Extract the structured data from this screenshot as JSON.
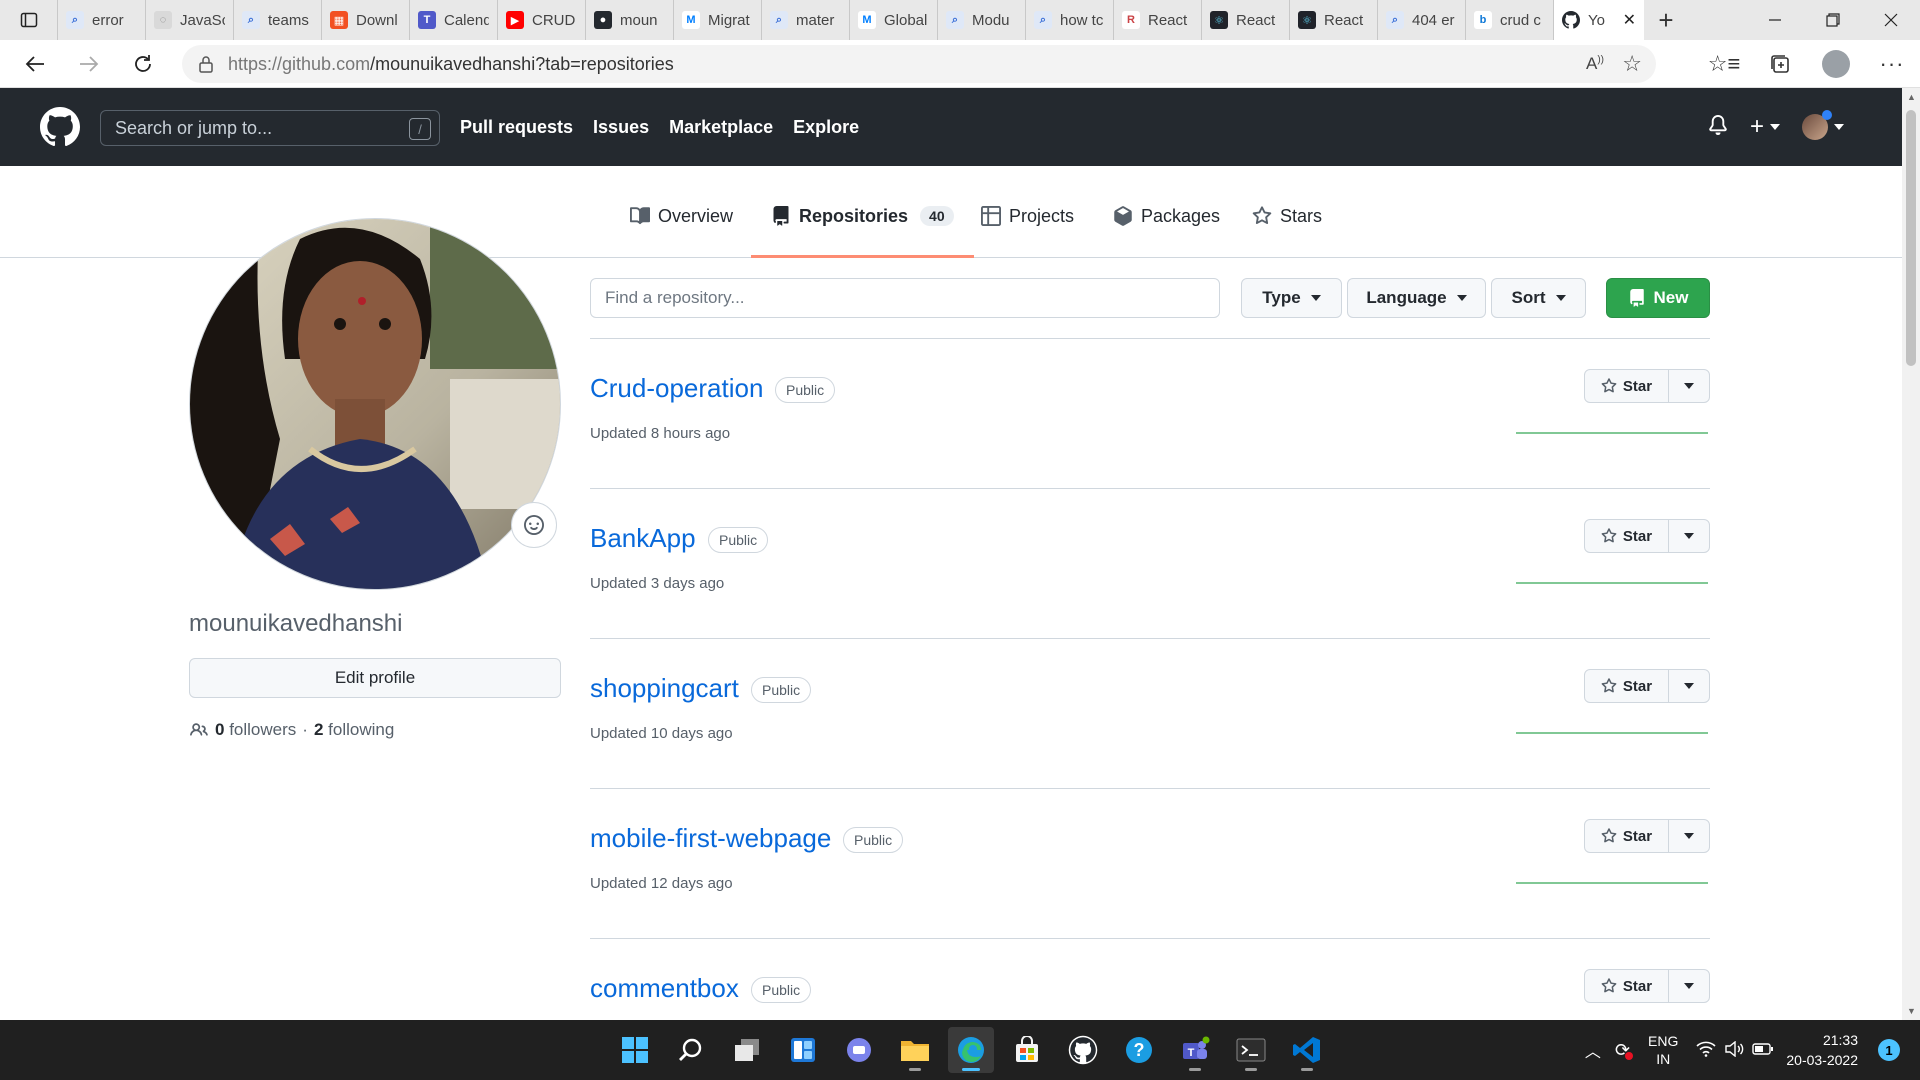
{
  "browser": {
    "tabs": [
      {
        "title": "error",
        "icon": "search-icon"
      },
      {
        "title": "JavaSc",
        "icon": "globe-icon"
      },
      {
        "title": "teams",
        "icon": "search-icon"
      },
      {
        "title": "Downl",
        "icon": "microsoft-icon"
      },
      {
        "title": "Calend",
        "icon": "teams-icon"
      },
      {
        "title": "CRUD",
        "icon": "youtube-icon"
      },
      {
        "title": "moun",
        "icon": "github-icon"
      },
      {
        "title": "Migrat",
        "icon": "mui-icon"
      },
      {
        "title": "mater",
        "icon": "search-icon"
      },
      {
        "title": "Global",
        "icon": "mui-icon"
      },
      {
        "title": "Modu",
        "icon": "search-icon"
      },
      {
        "title": "how tc",
        "icon": "search-icon"
      },
      {
        "title": "React",
        "icon": "react-router-icon"
      },
      {
        "title": "React",
        "icon": "react-icon"
      },
      {
        "title": "React",
        "icon": "react-icon"
      },
      {
        "title": "404 er",
        "icon": "search-icon"
      },
      {
        "title": "crud c",
        "icon": "bing-icon"
      }
    ],
    "active_tab": {
      "title": "Yo",
      "icon": "github-icon"
    },
    "url_host": "https://github.com",
    "url_path": "/mounuikavedhanshi?tab=repositories"
  },
  "github": {
    "search_placeholder": "Search or jump to...",
    "search_shortcut": "/",
    "nav": [
      "Pull requests",
      "Issues",
      "Marketplace",
      "Explore"
    ]
  },
  "profile_tabs": {
    "overview": "Overview",
    "repositories": "Repositories",
    "repo_count": "40",
    "projects": "Projects",
    "packages": "Packages",
    "stars": "Stars"
  },
  "profile": {
    "username": "mounuikavedhanshi",
    "edit_label": "Edit profile",
    "followers_count": "0",
    "followers_label": "followers",
    "separator": "·",
    "following_count": "2",
    "following_label": "following"
  },
  "repo_filters": {
    "find_placeholder": "Find a repository...",
    "type_label": "Type",
    "language_label": "Language",
    "sort_label": "Sort",
    "new_label": "New"
  },
  "repos": [
    {
      "name": "Crud-operation",
      "visibility": "Public",
      "updated": "Updated 8 hours ago",
      "star_label": "Star"
    },
    {
      "name": "BankApp",
      "visibility": "Public",
      "updated": "Updated 3 days ago",
      "star_label": "Star"
    },
    {
      "name": "shoppingcart",
      "visibility": "Public",
      "updated": "Updated 10 days ago",
      "star_label": "Star"
    },
    {
      "name": "mobile-first-webpage",
      "visibility": "Public",
      "updated": "Updated 12 days ago",
      "star_label": "Star"
    },
    {
      "name": "commentbox",
      "visibility": "Public",
      "updated": "",
      "star_label": "Star"
    }
  ],
  "taskbar": {
    "apps": [
      "windows-start-icon",
      "search-icon",
      "task-view-icon",
      "widgets-icon",
      "chat-icon",
      "file-explorer-icon",
      "edge-icon",
      "store-icon",
      "github-desktop-icon",
      "help-icon",
      "teams-icon",
      "terminal-icon",
      "vscode-icon"
    ],
    "lang_line1": "ENG",
    "lang_line2": "IN",
    "time": "21:33",
    "date": "20-03-2022",
    "notifications": "1"
  },
  "colors": {
    "gh_header_bg": "#24292f",
    "link_blue": "#0969da",
    "new_button_green": "#2da44e",
    "tab_underline": "#fd8c73",
    "sparkline": "#2da44e"
  }
}
